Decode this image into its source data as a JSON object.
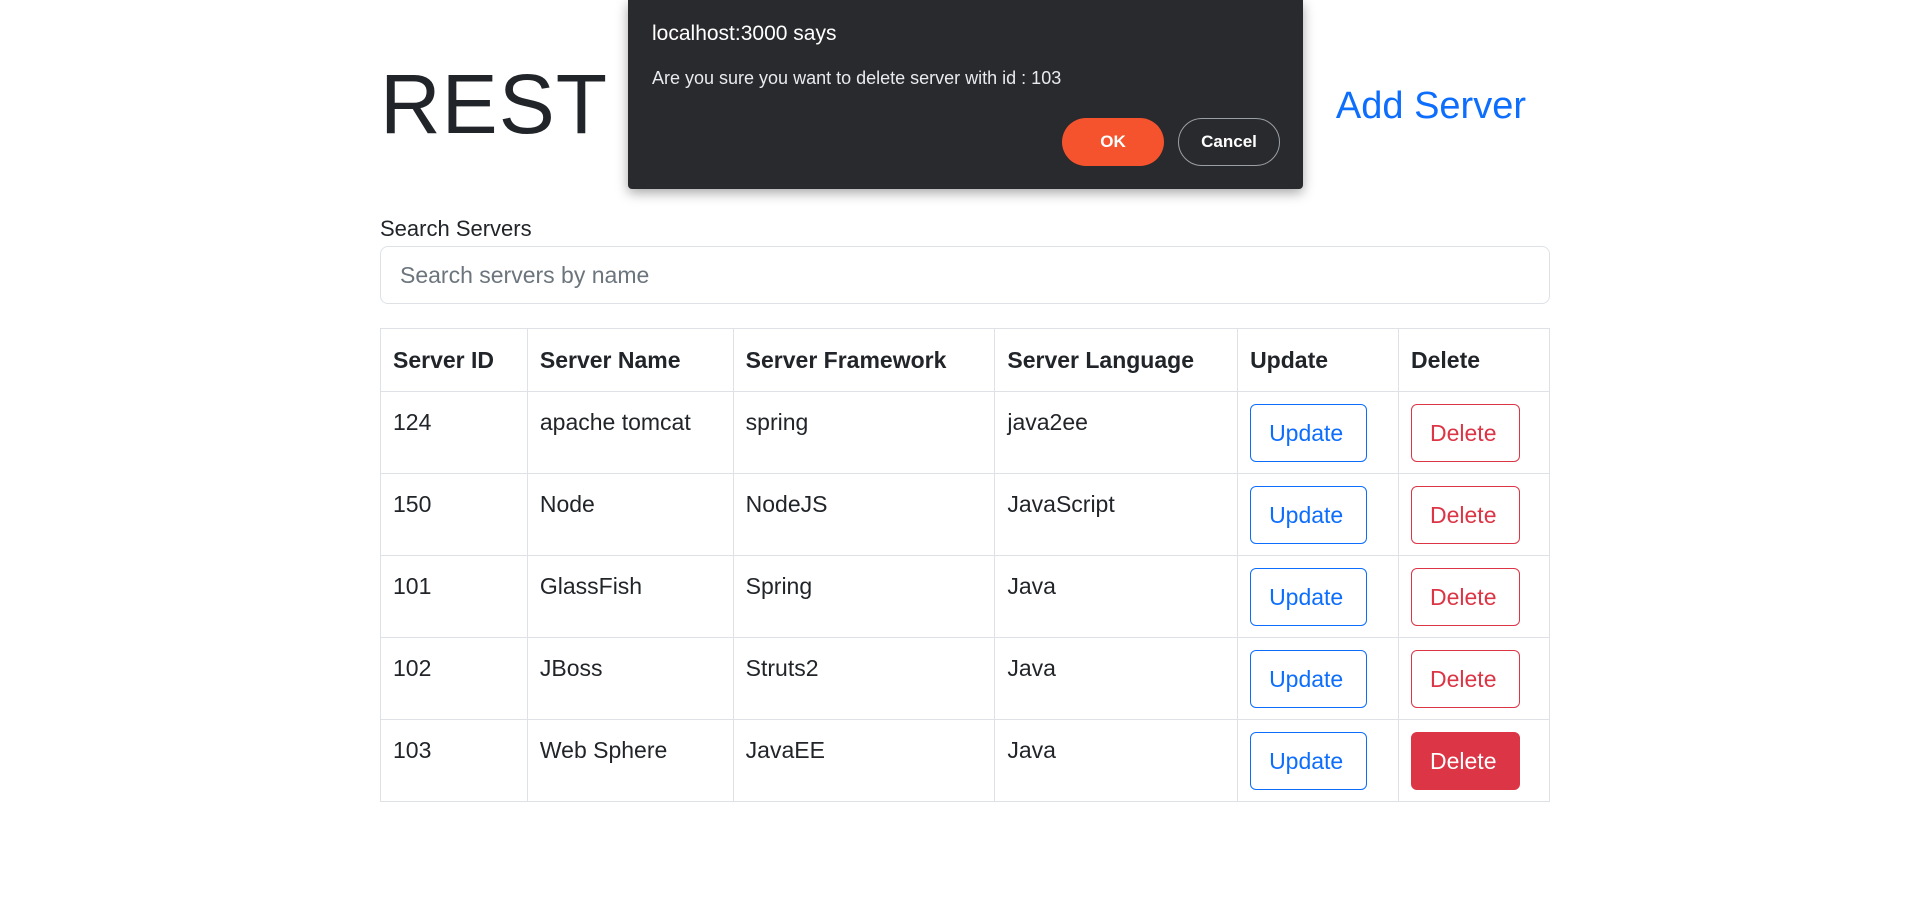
{
  "header": {
    "title": "REST Servers",
    "add_server_link": "Add Server"
  },
  "search": {
    "label": "Search Servers",
    "placeholder": "Search servers by name",
    "value": ""
  },
  "table": {
    "headers": [
      "Server ID",
      "Server Name",
      "Server Framework",
      "Server Language",
      "Update",
      "Delete"
    ],
    "rows": [
      {
        "id": "124",
        "name": "apache tomcat",
        "framework": "spring",
        "language": "java2ee",
        "update_label": "Update",
        "delete_label": "Delete"
      },
      {
        "id": "150",
        "name": "Node",
        "framework": "NodeJS",
        "language": "JavaScript",
        "update_label": "Update",
        "delete_label": "Delete"
      },
      {
        "id": "101",
        "name": "GlassFish",
        "framework": "Spring",
        "language": "Java",
        "update_label": "Update",
        "delete_label": "Delete"
      },
      {
        "id": "102",
        "name": "JBoss",
        "framework": "Struts2",
        "language": "Java",
        "update_label": "Update",
        "delete_label": "Delete"
      },
      {
        "id": "103",
        "name": "Web Sphere",
        "framework": "JavaEE",
        "language": "Java",
        "update_label": "Update",
        "delete_label": "Delete"
      }
    ]
  },
  "dialog": {
    "title": "localhost:3000 says",
    "message": "Are you sure you want to delete server with id : 103",
    "ok_label": "OK",
    "cancel_label": "Cancel"
  },
  "colors": {
    "primary": "#0d6efd",
    "danger": "#dc3545",
    "dialog_bg": "#292a2d",
    "dialog_ok": "#f5532d"
  }
}
